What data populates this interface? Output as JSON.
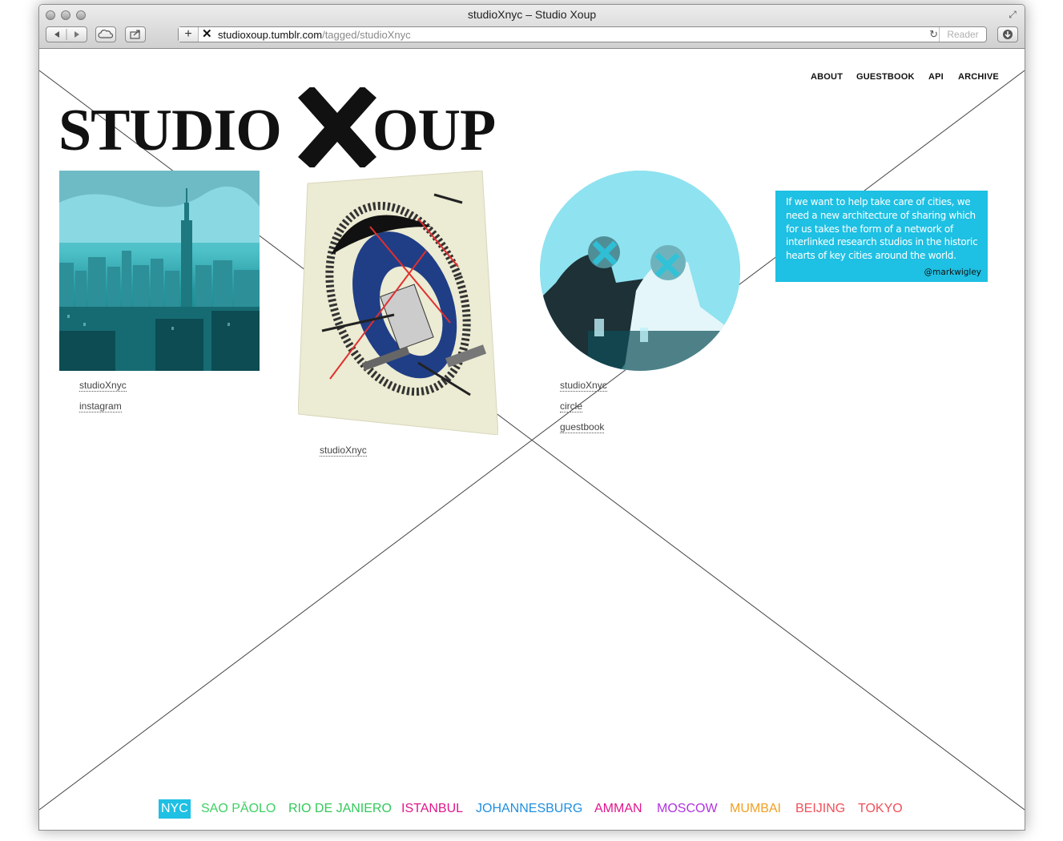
{
  "browser": {
    "window_title": "studioXnyc – Studio Xoup",
    "url_host": "studioxoup.tumblr.com",
    "url_path": "/tagged/studioXnyc",
    "reader_label": "Reader",
    "favicon_glyph": "✕"
  },
  "nav": {
    "about": "ABOUT",
    "guestbook": "GUESTBOOK",
    "api": "API",
    "archive": "ARCHIVE"
  },
  "logo": {
    "word1": "STUDIO",
    "word2": "OUP"
  },
  "posts": [
    {
      "tags": [
        "studioXnyc",
        "instagram"
      ]
    },
    {
      "tags": [
        "studioXnyc"
      ]
    },
    {
      "tags": [
        "studioXnyc",
        "circle",
        "guestbook"
      ]
    }
  ],
  "quote": {
    "text": "If we want to help take care of cities, we need a new architecture of sharing which for us takes the form of a network of interlinked research studios in the historic hearts of key cities around the world.",
    "author": "@markwigley"
  },
  "cities": [
    {
      "name": "NYC",
      "color": "#1ec0e3",
      "active": true
    },
    {
      "name": "SAO PĀOLO",
      "color": "#3dd063"
    },
    {
      "name": "RIO DE JANIERO",
      "color": "#32c95a"
    },
    {
      "name": "ISTANBUL",
      "color": "#e0178c"
    },
    {
      "name": "JOHANNESBURG",
      "color": "#1f8fe0"
    },
    {
      "name": "AMMAN",
      "color": "#e0178c"
    },
    {
      "name": "MOSCOW",
      "color": "#b233e0"
    },
    {
      "name": "MUMBAI",
      "color": "#f0a023"
    },
    {
      "name": "BEIJING",
      "color": "#f0505a"
    },
    {
      "name": "TOKYO",
      "color": "#f0505a"
    }
  ]
}
